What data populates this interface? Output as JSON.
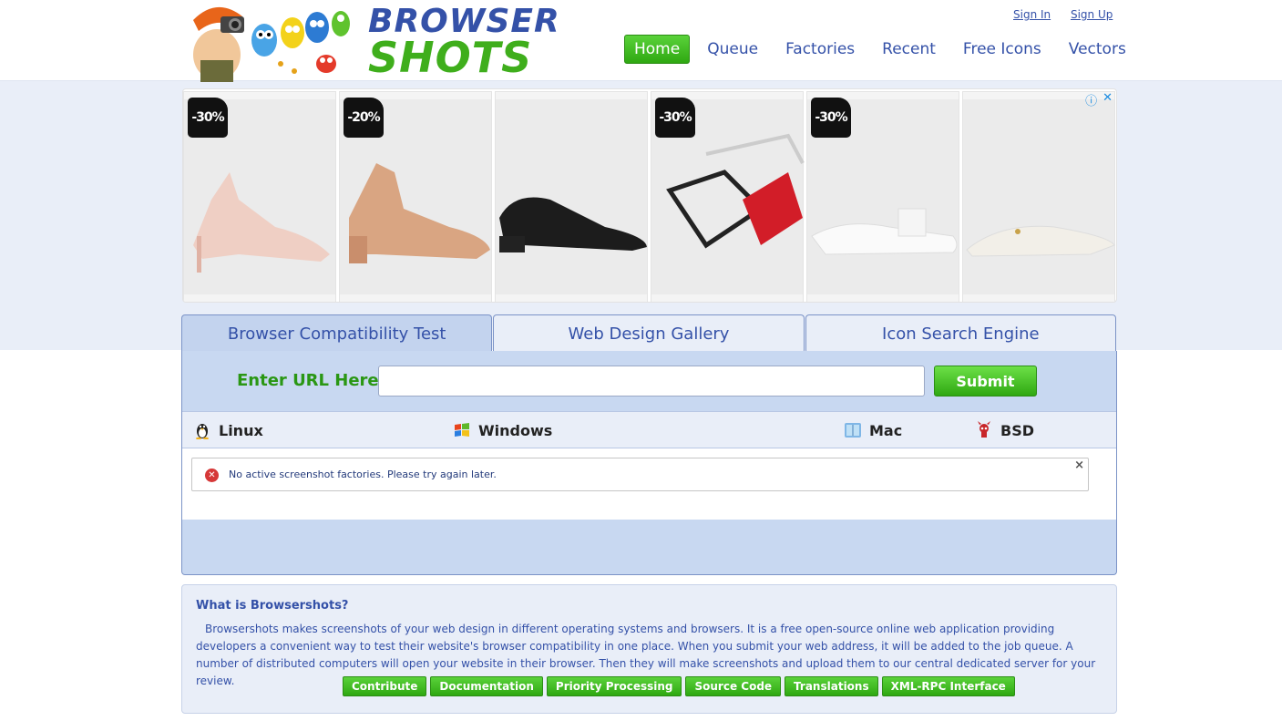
{
  "header": {
    "logo_line1": "BROWSER",
    "logo_line2": "SHOTS",
    "sign_in": "Sign In",
    "sign_up": "Sign Up"
  },
  "nav": {
    "items": [
      {
        "label": "Home",
        "active": true
      },
      {
        "label": "Queue",
        "active": false
      },
      {
        "label": "Factories",
        "active": false
      },
      {
        "label": "Recent",
        "active": false
      },
      {
        "label": "Free Icons",
        "active": false
      },
      {
        "label": "Vectors",
        "active": false
      }
    ]
  },
  "ad": {
    "info_icon": "info-icon",
    "close_icon": "close-icon",
    "cards": [
      {
        "discount": "-30%",
        "product": "pink-heel-sandal"
      },
      {
        "discount": "-20%",
        "product": "tan-block-heel-sandal"
      },
      {
        "discount": "",
        "product": "black-loafer"
      },
      {
        "discount": "-30%",
        "product": "strappy-sandals"
      },
      {
        "discount": "-30%",
        "product": "white-flat-sandal"
      },
      {
        "discount": "",
        "product": "white-mule"
      }
    ]
  },
  "tabs": [
    {
      "label": "Browser Compatibility Test",
      "active": true
    },
    {
      "label": "Web Design Gallery",
      "active": false
    },
    {
      "label": "Icon Search Engine",
      "active": false
    }
  ],
  "form": {
    "url_label": "Enter URL Here:",
    "url_value": "",
    "submit_label": "Submit"
  },
  "os": [
    {
      "label": "Linux",
      "icon": "tux-icon"
    },
    {
      "label": "Windows",
      "icon": "windows-icon"
    },
    {
      "label": "Mac",
      "icon": "mac-icon"
    },
    {
      "label": "BSD",
      "icon": "bsd-daemon-icon"
    }
  ],
  "alert": {
    "message": "No active screenshot factories. Please try again later.",
    "close": "×"
  },
  "about": {
    "title": "What is Browsershots?",
    "text": "Browsershots makes screenshots of your web design in different operating systems and browsers. It is a free open-source online web application providing developers a convenient way to test their website's browser compatibility in one place. When you submit your web address, it will be added to the job queue. A number of distributed computers will open your website in their browser. Then they will make screenshots and upload them to our central dedicated server for your review.",
    "links": [
      "Contribute",
      "Documentation",
      "Priority Processing",
      "Source Code",
      "Translations",
      "XML-RPC Interface"
    ]
  },
  "colors": {
    "accent_green": "#3fae1c",
    "brand_blue": "#3451a8",
    "panel_blue": "#c8d8f1"
  }
}
